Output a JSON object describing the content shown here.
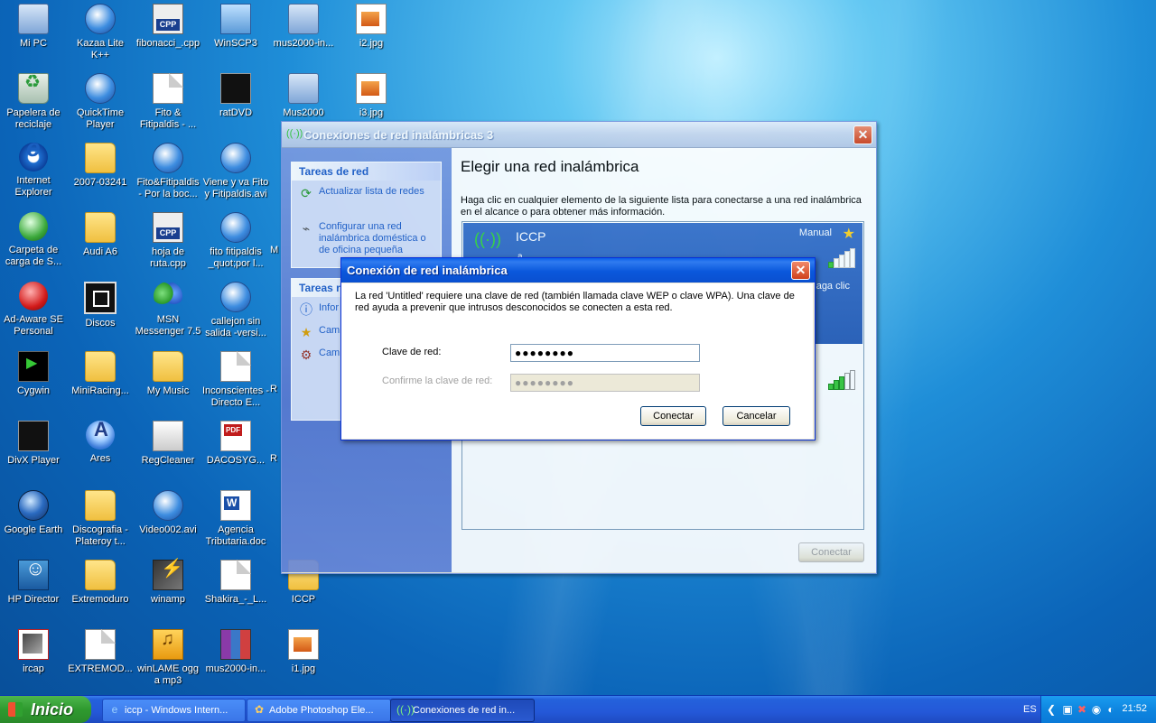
{
  "desktop": {
    "icons": [
      {
        "label": "Mi PC",
        "icon": "computer-icon"
      },
      {
        "label": "Kazaa Lite K++",
        "icon": "kazaa-icon"
      },
      {
        "label": "fibonacci_.cpp",
        "icon": "cpp-file-icon"
      },
      {
        "label": "WinSCP3",
        "icon": "winscp-icon"
      },
      {
        "label": "mus2000-in...",
        "icon": "program-icon"
      },
      {
        "label": "i2.jpg",
        "icon": "image-file-icon"
      },
      {
        "label": "Papelera de reciclaje",
        "icon": "recycle-bin-icon"
      },
      {
        "label": "QuickTime Player",
        "icon": "quicktime-icon"
      },
      {
        "label": "Fito & Fitipaldis - ...",
        "icon": "audio-file-icon"
      },
      {
        "label": "ratDVD",
        "icon": "ratdvd-icon"
      },
      {
        "label": "Mus2000",
        "icon": "mus2000-icon"
      },
      {
        "label": "i3.jpg",
        "icon": "image-file-icon"
      },
      {
        "label": "Internet Explorer",
        "icon": "internet-explorer-icon"
      },
      {
        "label": "2007-03241",
        "icon": "folder-icon"
      },
      {
        "label": "Fito&Fitipaldis - Por la boc...",
        "icon": "video-file-icon"
      },
      {
        "label": "Viene y va Fito y Fitipaldis.avi",
        "icon": "video-file-icon"
      },
      {
        "label": "Carpeta de carga de S...",
        "icon": "hp-folder-icon"
      },
      {
        "label": "Audi A6",
        "icon": "folder-icon"
      },
      {
        "label": "hoja de ruta.cpp",
        "icon": "cpp-file-icon"
      },
      {
        "label": "fito fitipaldis _quot;por l...",
        "icon": "video-file-icon"
      },
      {
        "label": "M",
        "icon": "partial-icon"
      },
      {
        "label": "Ad-Aware SE Personal",
        "icon": "adaware-icon"
      },
      {
        "label": "Discos",
        "icon": "discos-icon"
      },
      {
        "label": "MSN Messenger 7.5",
        "icon": "msn-icon"
      },
      {
        "label": "callejon sin salida -versi...",
        "icon": "video-file-icon"
      },
      {
        "label": "Cygwin",
        "icon": "cygwin-icon"
      },
      {
        "label": "MiniRacing...",
        "icon": "folder-icon"
      },
      {
        "label": "My Music",
        "icon": "folder-icon"
      },
      {
        "label": "Inconscientes - Directo E...",
        "icon": "audio-file-icon"
      },
      {
        "label": "R",
        "icon": "partial-icon"
      },
      {
        "label": "DivX Player",
        "icon": "divx-icon"
      },
      {
        "label": "Ares",
        "icon": "ares-icon"
      },
      {
        "label": "RegCleaner",
        "icon": "regcleaner-icon"
      },
      {
        "label": "DACOSYG...",
        "icon": "pdf-file-icon"
      },
      {
        "label": "R",
        "icon": "partial-icon"
      },
      {
        "label": "Google Earth",
        "icon": "google-earth-icon"
      },
      {
        "label": "Discografia - Plateroy t...",
        "icon": "folder-icon"
      },
      {
        "label": "Video002.avi",
        "icon": "video-file-icon"
      },
      {
        "label": "Agencia Tributaria.doc",
        "icon": "word-file-icon"
      },
      {
        "label": "HP Director",
        "icon": "hp-director-icon"
      },
      {
        "label": "Extremoduro",
        "icon": "folder-icon"
      },
      {
        "label": "winamp",
        "icon": "winamp-icon"
      },
      {
        "label": "Shakira_-_L...",
        "icon": "audio-file-icon"
      },
      {
        "label": "ICCP",
        "icon": "folder-icon"
      },
      {
        "label": "ircap",
        "icon": "ircap-icon"
      },
      {
        "label": "EXTREMOD...",
        "icon": "audio-file-icon"
      },
      {
        "label": "winLAME ogg a mp3",
        "icon": "winlame-icon"
      },
      {
        "label": "mus2000-in...",
        "icon": "rar-file-icon"
      },
      {
        "label": "i1.jpg",
        "icon": "image-file-icon"
      }
    ]
  },
  "main_window": {
    "title": "Conexiones de red inalámbricas 3",
    "tasks_header": "Tareas de red",
    "task_refresh": "Actualizar lista de redes",
    "task_configure": "Configurar una red inalámbrica doméstica o de oficina pequeña",
    "related_header": "Tareas r",
    "related_info": "Infor inalá",
    "related_order": "Camb redes",
    "related_advanced": "Camb avan",
    "heading": "Elegir una red inalámbrica",
    "description": "Haga clic en cualquier elemento de la siguiente lista para conectarse a una red inalámbrica en el alcance o para obtener más información.",
    "network_name": "ICCP",
    "network_mode": "Manual",
    "network_hint": "haga clic",
    "network_sub": "a",
    "connect_button": "Conectar"
  },
  "dialog": {
    "title": "Conexión de red inalámbrica",
    "message": "La red 'Untitled' requiere una clave de red (también llamada clave WEP o clave WPA). Una clave de red ayuda a prevenir que intrusos desconocidos se conecten a esta red.",
    "key_label": "Clave de red:",
    "key_value": "●●●●●●●●",
    "confirm_label": "Confirme la clave de red:",
    "confirm_value": "●●●●●●●●",
    "connect_button": "Conectar",
    "cancel_button": "Cancelar"
  },
  "taskbar": {
    "start_label": "Inicio",
    "buttons": [
      {
        "label": "iccp - Windows Intern...",
        "icon": "internet-explorer-icon"
      },
      {
        "label": "Adobe Photoshop Ele...",
        "icon": "photoshop-icon"
      },
      {
        "label": "Conexiones de red in...",
        "icon": "wireless-icon"
      }
    ],
    "language": "ES",
    "clock": "21:52"
  }
}
